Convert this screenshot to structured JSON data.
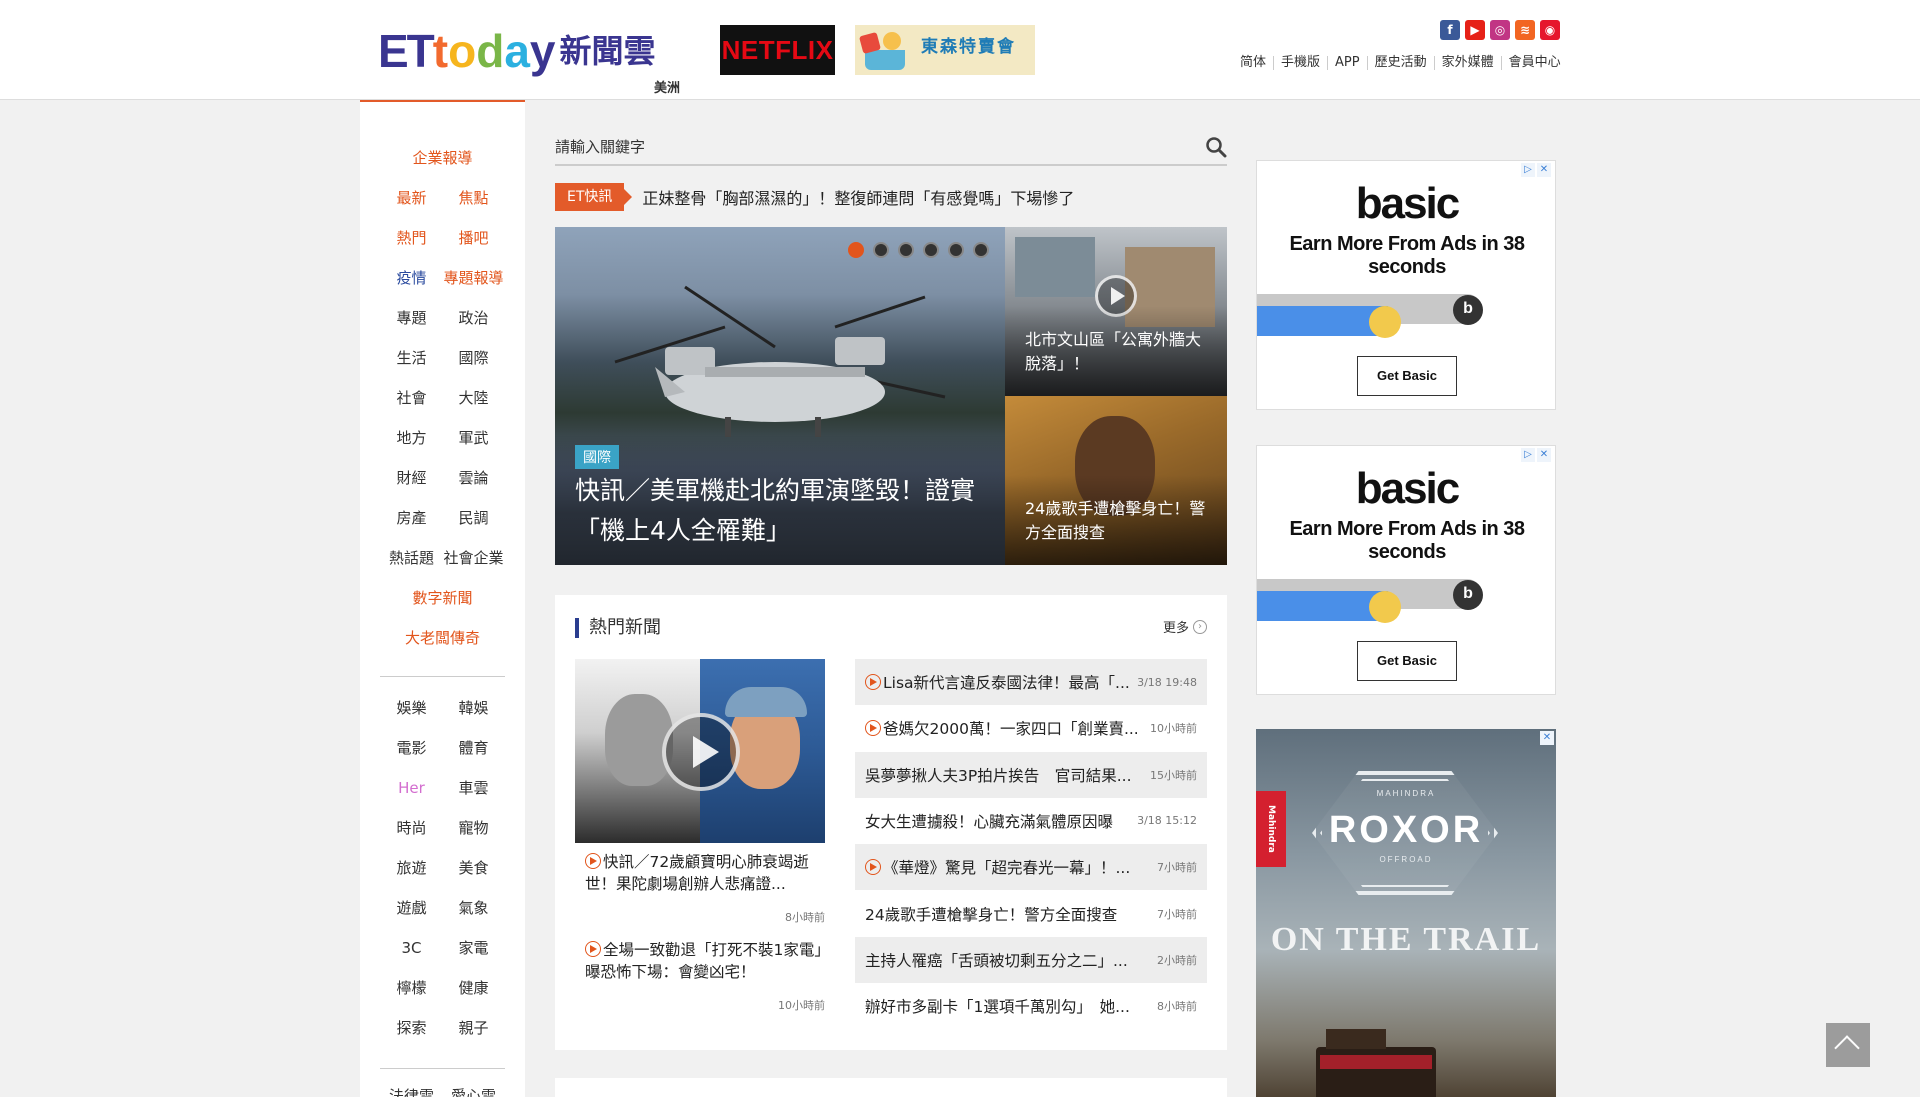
{
  "header": {
    "logo_text": "ETtoday",
    "logo_cn": "新聞雲",
    "region": "美洲",
    "banner1": "NETFLIX",
    "banner2": "東森特賣會",
    "social": [
      "facebook-icon",
      "youtube-icon",
      "instagram-icon",
      "rss-icon",
      "weibo-icon"
    ],
    "top_links": [
      "简体",
      "手機版",
      "APP",
      "歷史活動",
      "家外媒體",
      "會員中心"
    ]
  },
  "sidebar": {
    "items": [
      {
        "label": "企業報導",
        "color": "orange"
      },
      {
        "label": "最新",
        "color": "orange"
      },
      {
        "label": "焦點",
        "color": "orange"
      },
      {
        "label": "熱門",
        "color": "orange"
      },
      {
        "label": "播吧",
        "color": "orange"
      },
      {
        "label": "疫情",
        "color": "blue"
      },
      {
        "label": "專題報導",
        "color": "orange"
      },
      {
        "label": "專題",
        "color": "default"
      },
      {
        "label": "政治",
        "color": "default"
      },
      {
        "label": "生活",
        "color": "default"
      },
      {
        "label": "國際",
        "color": "default"
      },
      {
        "label": "社會",
        "color": "default"
      },
      {
        "label": "大陸",
        "color": "default"
      },
      {
        "label": "地方",
        "color": "default"
      },
      {
        "label": "軍武",
        "color": "default"
      },
      {
        "label": "財經",
        "color": "default"
      },
      {
        "label": "雲論",
        "color": "default"
      },
      {
        "label": "房產",
        "color": "default"
      },
      {
        "label": "民調",
        "color": "default"
      },
      {
        "label": "熱話題",
        "color": "default"
      },
      {
        "label": "社會企業",
        "color": "default"
      },
      {
        "label": "數字新聞",
        "color": "orange"
      },
      {
        "label": "大老闆傳奇",
        "color": "orange"
      },
      {
        "label": "娛樂",
        "color": "default"
      },
      {
        "label": "韓娛",
        "color": "default"
      },
      {
        "label": "電影",
        "color": "default"
      },
      {
        "label": "體育",
        "color": "default"
      },
      {
        "label": "Her",
        "color": "pink"
      },
      {
        "label": "車雲",
        "color": "default"
      },
      {
        "label": "時尚",
        "color": "default"
      },
      {
        "label": "寵物",
        "color": "default"
      },
      {
        "label": "旅遊",
        "color": "default"
      },
      {
        "label": "美食",
        "color": "default"
      },
      {
        "label": "遊戲",
        "color": "default"
      },
      {
        "label": "氣象",
        "color": "default"
      },
      {
        "label": "3C",
        "color": "default"
      },
      {
        "label": "家電",
        "color": "default"
      },
      {
        "label": "檸檬",
        "color": "default"
      },
      {
        "label": "健康",
        "color": "default"
      },
      {
        "label": "探索",
        "color": "default"
      },
      {
        "label": "親子",
        "color": "default"
      },
      {
        "label": "法律雲",
        "color": "default"
      },
      {
        "label": "愛心雲",
        "color": "default"
      }
    ]
  },
  "search": {
    "placeholder": "請輸入關鍵字"
  },
  "flash": {
    "tag": "ET快訊",
    "text": "正妹整骨「胸部濕濕的」！整復師連問「有感覺嗎」下場慘了"
  },
  "hero": {
    "category": "國際",
    "title": "快訊／美軍機赴北約軍演墜毀！證實「機上4人全罹難」",
    "slides": 6,
    "active_slide": 0,
    "side1": "北市文山區「公寓外牆大脫落」！",
    "side2": "24歲歌手遭槍擊身亡！警方全面搜查"
  },
  "hot": {
    "heading": "熱門新聞",
    "more": "更多",
    "left_stories": [
      {
        "title": "快訊／72歲顧寶明心肺衰竭逝世！果陀劇場創辦人悲痛證...",
        "time": "8小時前",
        "video": true
      },
      {
        "title": "全場一致勸退「打死不裝1家電」　曝恐怖下場：會變凶宅！",
        "time": "10小時前",
        "video": true
      }
    ],
    "rows": [
      {
        "title": "Lisa新代言違反泰國法律！最高「...",
        "time": "3/18 19:48",
        "video": true
      },
      {
        "title": "爸媽欠2000萬！一家四口「創業賣...",
        "time": "10小時前",
        "video": true
      },
      {
        "title": "吳夢夢揪人夫3P拍片挨告　官司結果...",
        "time": "15小時前",
        "video": false
      },
      {
        "title": "女大生遭擄殺！心臟充滿氣體原因曝",
        "time": "3/18 15:12",
        "video": false
      },
      {
        "title": "《華燈》驚見「超完春光一幕」！...",
        "time": "7小時前",
        "video": true
      },
      {
        "title": "24歲歌手遭槍擊身亡！警方全面搜查",
        "time": "7小時前",
        "video": false
      },
      {
        "title": "主持人罹癌「舌頭被切剩五分之二」...",
        "time": "2小時前",
        "video": false
      },
      {
        "title": "辦好市多副卡「1選項千萬別勾」　她...",
        "time": "8小時前",
        "video": false
      }
    ]
  },
  "ads": {
    "basic": {
      "brand": "basic",
      "headline": "Earn More From Ads in 38 seconds",
      "button": "Get Basic",
      "b_letter": "b",
      "progress": 0.58
    },
    "roxor": {
      "side": "Mahindra",
      "top": "MAHINDRA",
      "brand": "ROXOR",
      "sub": "OFFROAD",
      "tagline": "ON THE TRAIL"
    }
  },
  "colors": {
    "accent": "#e2551c",
    "nav_blue": "#2a3d8f",
    "link_blue": "#3aa3c6"
  }
}
